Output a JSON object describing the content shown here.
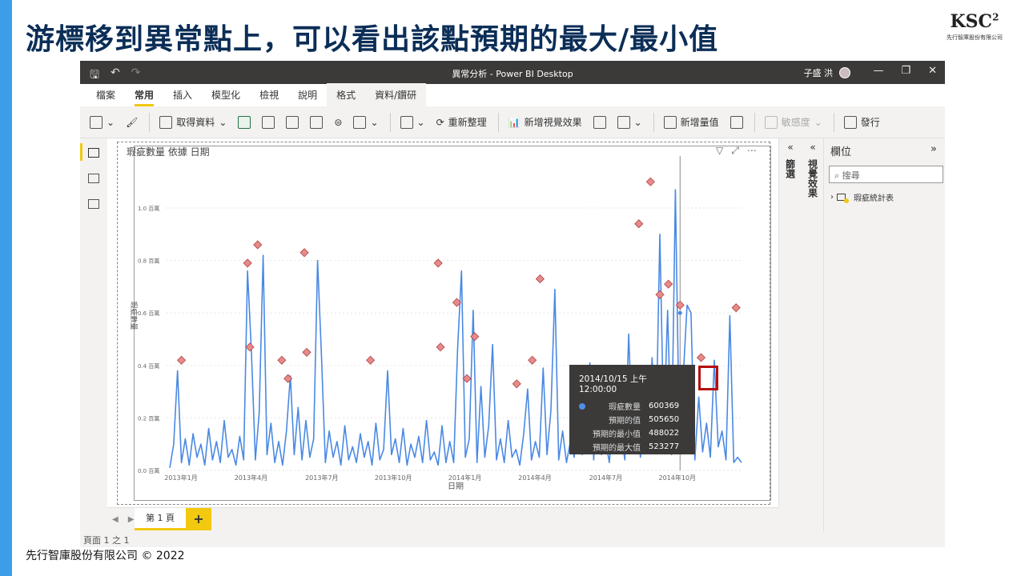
{
  "slide": {
    "title": "游標移到異常點上，可以看出該點預期的最大/最小值",
    "logo_mark": "KSC",
    "logo_sup": "2",
    "logo_sub": "先行智庫股份有限公司",
    "footer": "先行智庫股份有限公司 © 2022"
  },
  "app": {
    "window_title": "異常分析 - Power BI Desktop",
    "user": "子盛 洪",
    "tabs": [
      "檔案",
      "常用",
      "插入",
      "模型化",
      "檢視",
      "說明",
      "格式",
      "資料/鑽研"
    ],
    "active_tab": "常用",
    "ribbon": {
      "get_data": "取得資料",
      "refresh": "重新整理",
      "new_visual": "新增視覺效果",
      "new_measure": "新增量值",
      "sensitivity": "敏感度",
      "publish": "發行"
    },
    "page_tab": "第 1 頁",
    "status": "頁面 1 之 1",
    "filters_label": "篩選",
    "visuals_label": "視覺效果",
    "fields_title": "欄位",
    "search_placeholder": "搜尋",
    "field_table": "瑕疵統計表"
  },
  "visual": {
    "title": "瑕疵數量 依據 日期"
  },
  "tooltip": {
    "header": "2014/10/15 上午 12:00:00",
    "rows": [
      {
        "label": "瑕疵數量",
        "value": "600369"
      },
      {
        "label": "預期的值",
        "value": "505650"
      },
      {
        "label": "預期的最小值",
        "value": "488022"
      },
      {
        "label": "預期的最大值",
        "value": "523277"
      }
    ]
  },
  "chart_data": {
    "type": "line",
    "xlabel": "日期",
    "ylabel": "瑕疵數量",
    "y_tick_labels": [
      "0.0 百萬",
      "0.2 百萬",
      "0.4 百萬",
      "0.6 百萬",
      "0.8 百萬",
      "1.0 百萬"
    ],
    "y_ticks": [
      0,
      0.2,
      0.4,
      0.6,
      0.8,
      1.0
    ],
    "x_tick_labels": [
      "2013年1月",
      "2013年4月",
      "2013年7月",
      "2013年10月",
      "2014年1月",
      "2014年4月",
      "2014年7月",
      "2014年10月"
    ],
    "x_ticks": [
      0,
      90,
      181,
      273,
      365,
      455,
      546,
      638
    ],
    "x_range": [
      0,
      735
    ],
    "ylim": [
      0,
      1.18
    ],
    "series": [
      {
        "name": "瑕疵數量",
        "color": "#4a89e3",
        "x": [
          0,
          5,
          10,
          15,
          20,
          25,
          30,
          35,
          40,
          45,
          50,
          55,
          60,
          65,
          70,
          75,
          80,
          85,
          90,
          95,
          100,
          105,
          110,
          115,
          120,
          125,
          130,
          135,
          140,
          145,
          150,
          155,
          160,
          165,
          170,
          175,
          180,
          185,
          190,
          195,
          200,
          205,
          210,
          215,
          220,
          225,
          230,
          235,
          240,
          245,
          250,
          255,
          260,
          265,
          270,
          275,
          280,
          285,
          290,
          295,
          300,
          305,
          310,
          315,
          320,
          325,
          330,
          335,
          340,
          345,
          350,
          355,
          360,
          365,
          370,
          375,
          380,
          385,
          390,
          395,
          400,
          405,
          410,
          415,
          420,
          425,
          430,
          435,
          440,
          445,
          450,
          455,
          460,
          465,
          470,
          475,
          480,
          485,
          490,
          495,
          500,
          505,
          510,
          515,
          520,
          525,
          530,
          535,
          540,
          545,
          550,
          555,
          560,
          565,
          570,
          575,
          580,
          585,
          590,
          595,
          600,
          605,
          610,
          615,
          620,
          625,
          630,
          635,
          640,
          645,
          650,
          655,
          660,
          665,
          670,
          675,
          680,
          685,
          690,
          695,
          700,
          705,
          710,
          715,
          720,
          725,
          730,
          735
        ],
        "y": [
          0.01,
          0.1,
          0.38,
          0.03,
          0.12,
          0.02,
          0.14,
          0.05,
          0.1,
          0.02,
          0.16,
          0.04,
          0.11,
          0.03,
          0.19,
          0.05,
          0.08,
          0.02,
          0.13,
          0.04,
          0.76,
          0.45,
          0.04,
          0.22,
          0.82,
          0.06,
          0.18,
          0.03,
          0.11,
          0.02,
          0.15,
          0.36,
          0.06,
          0.24,
          0.04,
          0.19,
          0.05,
          0.12,
          0.8,
          0.44,
          0.03,
          0.15,
          0.05,
          0.11,
          0.02,
          0.17,
          0.04,
          0.09,
          0.03,
          0.14,
          0.05,
          0.11,
          0.02,
          0.18,
          0.04,
          0.08,
          0.38,
          0.06,
          0.12,
          0.03,
          0.16,
          0.02,
          0.1,
          0.05,
          0.13,
          0.03,
          0.19,
          0.04,
          0.07,
          0.02,
          0.17,
          0.03,
          0.11,
          0.03,
          0.46,
          0.76,
          0.05,
          0.12,
          0.61,
          0.03,
          0.32,
          0.05,
          0.17,
          0.48,
          0.04,
          0.12,
          0.03,
          0.19,
          0.05,
          0.08,
          0.02,
          0.14,
          0.31,
          0.04,
          0.11,
          0.05,
          0.39,
          0.06,
          0.23,
          0.69,
          0.04,
          0.15,
          0.03,
          0.11,
          0.05,
          0.29,
          0.06,
          0.14,
          0.41,
          0.04,
          0.35,
          0.06,
          0.12,
          0.03,
          0.2,
          0.07,
          0.15,
          0.04,
          0.52,
          0.11,
          0.25,
          0.05,
          0.18,
          0.07,
          0.43,
          0.12,
          0.9,
          0.15,
          0.61,
          0.06,
          1.07,
          0.12,
          0.35,
          0.63,
          0.6,
          0.04,
          0.28,
          0.07,
          0.18,
          0.05,
          0.42,
          0.09,
          0.15,
          0.04,
          0.59,
          0.03,
          0.05,
          0.03
        ],
        "anomalies": [
          {
            "x": 15,
            "y": 0.42
          },
          {
            "x": 100,
            "y": 0.79
          },
          {
            "x": 103,
            "y": 0.47
          },
          {
            "x": 113,
            "y": 0.86
          },
          {
            "x": 144,
            "y": 0.42
          },
          {
            "x": 152,
            "y": 0.35
          },
          {
            "x": 173,
            "y": 0.83
          },
          {
            "x": 176,
            "y": 0.45
          },
          {
            "x": 258,
            "y": 0.42
          },
          {
            "x": 345,
            "y": 0.79
          },
          {
            "x": 348,
            "y": 0.47
          },
          {
            "x": 369,
            "y": 0.64
          },
          {
            "x": 382,
            "y": 0.35
          },
          {
            "x": 392,
            "y": 0.51
          },
          {
            "x": 446,
            "y": 0.33
          },
          {
            "x": 466,
            "y": 0.42
          },
          {
            "x": 476,
            "y": 0.73
          },
          {
            "x": 603,
            "y": 0.94
          },
          {
            "x": 618,
            "y": 1.1
          },
          {
            "x": 630,
            "y": 0.67
          },
          {
            "x": 641,
            "y": 0.71
          },
          {
            "x": 656,
            "y": 0.63
          },
          {
            "x": 683,
            "y": 0.43
          },
          {
            "x": 728,
            "y": 0.62
          }
        ]
      }
    ],
    "hover": {
      "x": 656,
      "y": 0.6
    }
  }
}
